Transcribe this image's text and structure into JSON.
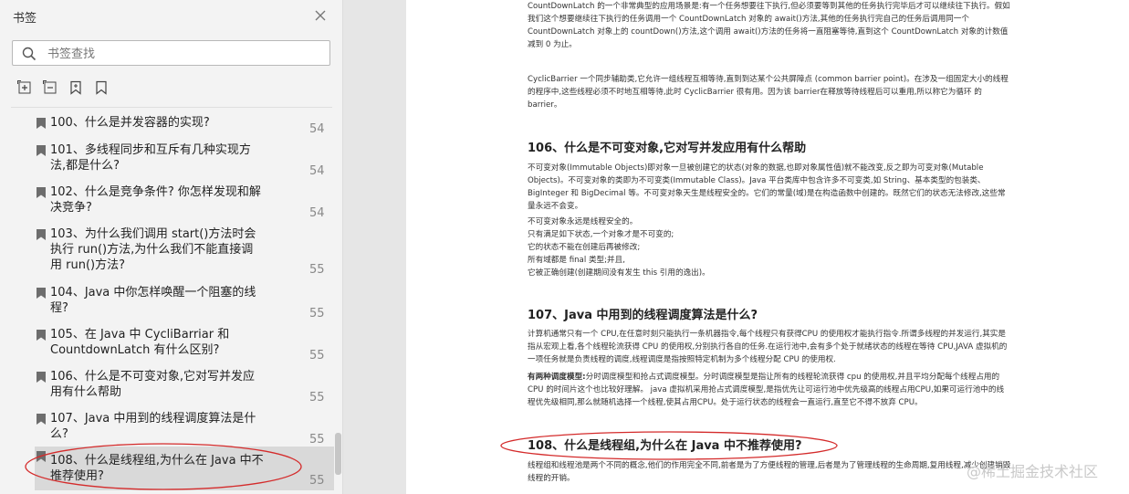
{
  "sidebar": {
    "title": "书签",
    "search_placeholder": "书签查找",
    "items": [
      {
        "label": "100、什么是并发容器的实现?",
        "page": "54"
      },
      {
        "label": "101、多线程同步和互斥有几种实现方法,都是什么?",
        "page": "54"
      },
      {
        "label": "102、什么是竞争条件? 你怎样发现和解决竞争?",
        "page": "54"
      },
      {
        "label": "103、为什么我们调用 start()方法时会执行 run()方法,为什么我们不能直接调用 run()方法?",
        "page": "55"
      },
      {
        "label": "104、Java 中你怎样唤醒一个阻塞的线程?",
        "page": "55"
      },
      {
        "label": "105、在 Java 中 CycliBarriar 和 CountdownLatch 有什么区别?",
        "page": "55"
      },
      {
        "label": "106、什么是不可变对象,它对写并发应用有什么帮助",
        "page": "55"
      },
      {
        "label": "107、Java 中用到的线程调度算法是什么?",
        "page": "55"
      },
      {
        "label": "108、什么是线程组,为什么在 Java 中不推荐使用?",
        "page": "55"
      }
    ]
  },
  "document": {
    "p1": "CountDownLatch 的一个非常典型的应用场景是:有一个任务想要往下执行,但必须要等到其他的任务执行完毕后才可以继续往下执行。假如我们这个想要继续往下执行的任务调用一个 CountDownLatch 对象的 await()方法,其他的任务执行完自己的任务后调用同一个 CountDownLatch 对象上的 countDown()方法,这个调用 await()方法的任务将一直阻塞等待,直到这个 CountDownLatch 对象的计数值减到 0 为止。",
    "p2": "CyclicBarrier 一个同步辅助类,它允许一组线程互相等待,直到到达某个公共屏障点 (common barrier point)。在涉及一组固定大小的线程的程序中,这些线程必须不时地互相等待,此时 CyclicBarrier 很有用。因为该 barrier在释放等待线程后可以重用,所以称它为循环 的 barrier。",
    "h106": "106、什么是不可变对象,它对写并发应用有什么帮助",
    "p3": "不可变对象(Immutable Objects)即对象一旦被创建它的状态(对象的数据,也即对象属性值)就不能改变,反之即为可变对象(Mutable Objects)。不可变对象的类即为不可变类(Immutable Class)。Java 平台类库中包含许多不可变类,如 String、基本类型的包装类、BigInteger 和 BigDecimal 等。不可变对象天生是线程安全的。它们的常量(域)是在构造函数中创建的。既然它们的状态无法修改,这些常量永远不会变。",
    "p4": "不可变对象永远是线程安全的。",
    "p5": "只有满足如下状态,一个对象才是不可变的;",
    "p6": "它的状态不能在创建后再被修改;",
    "p7": "所有域都是 final 类型;并且,",
    "p8": "它被正确创建(创建期间没有发生 this 引用的逸出)。",
    "h107": "107、Java 中用到的线程调度算法是什么?",
    "p9": "计算机通常只有一个 CPU,在任意时刻只能执行一条机器指令,每个线程只有获得CPU 的使用权才能执行指令.所谓多线程的并发运行,其实是指从宏观上看,各个线程轮流获得 CPU 的使用权,分别执行各自的任务.在运行池中,会有多个处于就绪状态的线程在等待 CPU,JAVA 虚拟机的一项任务就是负责线程的调度,线程调度是指按照特定机制为多个线程分配 CPU 的使用权.",
    "p10_bold": "有两种调度模型:",
    "p10": "分时调度模型和抢占式调度模型。分时调度模型是指让所有的线程轮流获得 cpu 的使用权,并且平均分配每个线程占用的 CPU 的时间片这个也比较好理解。 java 虚拟机采用抢占式调度模型,是指优先让可运行池中优先级高的线程占用CPU,如果可运行池中的线程优先级相同,那么就随机选择一个线程,使其占用CPU。处于运行状态的线程会一直运行,直至它不得不放弃 CPU。",
    "h108": "108、什么是线程组,为什么在 Java 中不推荐使用?",
    "p11": "线程组和线程池是两个不同的概念,他们的作用完全不同,前者是为了方便线程的管理,后者是为了管理线程的生命周期,复用线程,减少创建销毁线程的开销。",
    "watermark": "@稀土掘金技术社区"
  }
}
